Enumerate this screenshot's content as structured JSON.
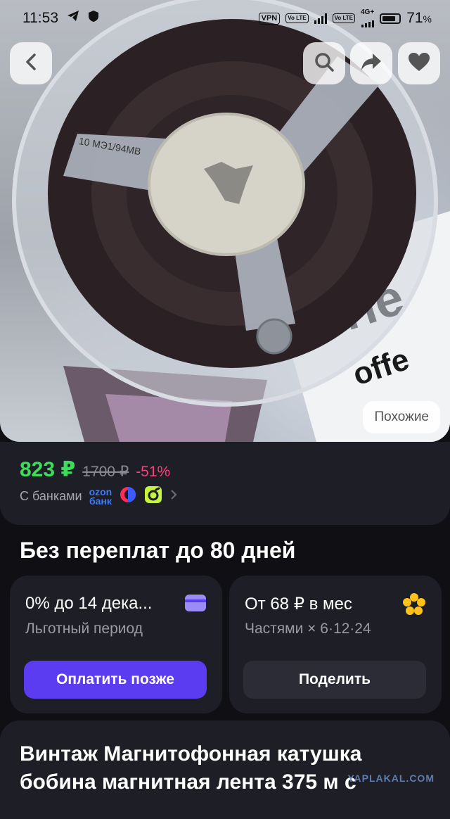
{
  "status_bar": {
    "time": "11:53",
    "vpn": "VPN",
    "volte1": "Vo LTE",
    "volte2": "Vo LTE",
    "network": "4G+",
    "battery": "71",
    "battery_unit": "%"
  },
  "photo": {
    "reel_label": "10 МЭ1/94МВ"
  },
  "buttons": {
    "back": "back",
    "search": "search",
    "share": "share",
    "favorite": "favorite",
    "similar": "Похожие"
  },
  "price": {
    "current": "823 ₽",
    "old": "1700 ₽",
    "discount": "-51%",
    "banks_label": "С банками",
    "ozon_line1": "ozon",
    "ozon_line2": "банк"
  },
  "installments": {
    "title": "Без переплат до 80 дней",
    "card1": {
      "heading": "0% до 14 дека...",
      "sub": "Льготный период",
      "button": "Оплатить позже",
      "accent": "#5b3cf0"
    },
    "card2": {
      "heading": "От 68 ₽ в мес",
      "sub": "Частями × 6·12·24",
      "button": "Поделить",
      "accent": "#2c2c36"
    }
  },
  "product": {
    "title": "Винтаж Магнитофонная катушка бобина магнитная лента 375 м с"
  },
  "watermark": "YAPLAKAL.COM",
  "colors": {
    "price_green": "#3ddc5a",
    "discount_pink": "#ff3f7a",
    "background": "#0f0f14",
    "card": "#1e1e26"
  }
}
